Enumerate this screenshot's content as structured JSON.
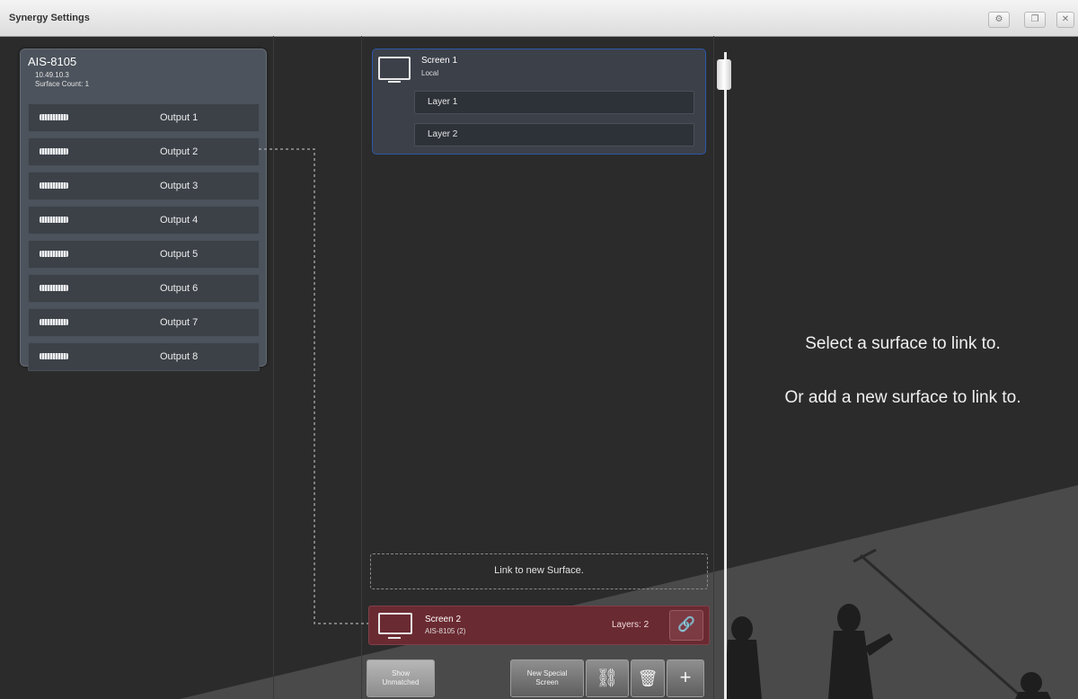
{
  "window": {
    "title": "Synergy Settings",
    "controls": [
      "gear-icon",
      "restore-icon",
      "close-icon"
    ]
  },
  "device": {
    "name": "AIS-8105",
    "ip": "10.49.10.3",
    "surface_count": "Surface Count: 1",
    "outputs": [
      "Output 1",
      "Output 2",
      "Output 3",
      "Output 4",
      "Output 5",
      "Output 6",
      "Output 7",
      "Output 8"
    ]
  },
  "screens": {
    "screen1": {
      "name": "Screen 1",
      "sub": "Local",
      "layers": [
        "Layer 1",
        "Layer 2"
      ]
    },
    "link_new_surface": "Link to new Surface.",
    "screen2": {
      "name": "Screen 2",
      "sub": "AIS-8105 (2)",
      "layers": "Layers: 2"
    }
  },
  "toolbar": {
    "show_unmatched": [
      "Show",
      "Unmatched"
    ],
    "new_special_screen": [
      "New Special",
      "Screen"
    ]
  },
  "message": {
    "line1": "Select a surface to link to.",
    "line2": "Or add a new surface to link to."
  },
  "colors": {
    "background": "#2b2b2b",
    "selected_border": "#2c57a8",
    "linked_screen": "#6a2a31"
  }
}
